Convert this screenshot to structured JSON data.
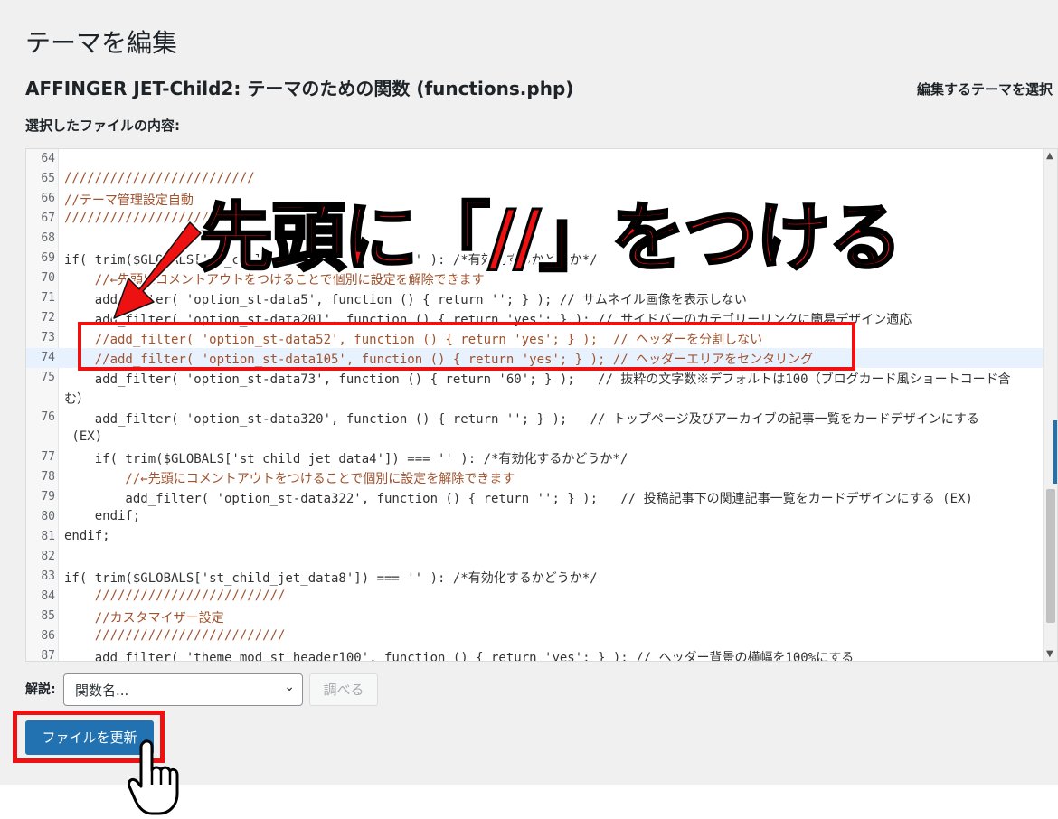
{
  "page": {
    "title": "テーマを編集",
    "subtitle": "AFFINGER JET-Child2: テーマのための関数 (functions.php)",
    "theme_select_label": "編集するテーマを選択",
    "file_label": "選択したファイルの内容:"
  },
  "editor": {
    "lines": [
      {
        "n": "64",
        "code": ""
      },
      {
        "n": "65",
        "code": "/////////////////////////"
      },
      {
        "n": "66",
        "code": "//テーマ管理設定自動"
      },
      {
        "n": "67",
        "code": "//////////////////////"
      },
      {
        "n": "68",
        "code": ""
      },
      {
        "n": "69",
        "code": "if( trim($GLOBALS['st_child_jet_data1']) === '' ): /*有効化するかどうか*/"
      },
      {
        "n": "70",
        "code": "    //←先頭にコメントアウトをつけることで個別に設定を解除できます"
      },
      {
        "n": "71",
        "code": "    add_filter( 'option_st-data5', function () { return ''; } ); // サムネイル画像を表示しない"
      },
      {
        "n": "72",
        "code": "    add_filter( 'option_st-data201', function () { return 'yes'; } ); // サイドバーのカテゴリーリンクに簡易デザイン適応"
      },
      {
        "n": "73",
        "code": "    //add_filter( 'option_st-data52', function () { return 'yes'; } );  // ヘッダーを分割しない"
      },
      {
        "n": "74",
        "code": "    //add_filter( 'option_st-data105', function () { return 'yes'; } ); // ヘッダーエリアをセンタリング"
      },
      {
        "n": "75",
        "code": "    add_filter( 'option_st-data73', function () { return '60'; } );   // 抜粋の文字数※デフォルトは100（ブログカード風ショートコード含"
      },
      {
        "n": "",
        "code": "む）"
      },
      {
        "n": "76",
        "code": "    add_filter( 'option_st-data320', function () { return ''; } );   // トップページ及びアーカイブの記事一覧をカードデザインにする"
      },
      {
        "n": "",
        "code": " (EX)"
      },
      {
        "n": "77",
        "code": "    if( trim($GLOBALS['st_child_jet_data4']) === '' ): /*有効化するかどうか*/"
      },
      {
        "n": "78",
        "code": "        //←先頭にコメントアウトをつけることで個別に設定を解除できます"
      },
      {
        "n": "79",
        "code": "        add_filter( 'option_st-data322', function () { return ''; } );   // 投稿記事下の関連記事一覧をカードデザインにする (EX)"
      },
      {
        "n": "80",
        "code": "    endif;"
      },
      {
        "n": "81",
        "code": "endif;"
      },
      {
        "n": "82",
        "code": ""
      },
      {
        "n": "83",
        "code": "if( trim($GLOBALS['st_child_jet_data8']) === '' ): /*有効化するかどうか*/"
      },
      {
        "n": "84",
        "code": "    /////////////////////////"
      },
      {
        "n": "85",
        "code": "    //カスタマイザー設定"
      },
      {
        "n": "86",
        "code": "    /////////////////////////"
      },
      {
        "n": "87",
        "code": "    add_filter( 'theme_mod_st_header100', function () { return 'yes'; } ); // ヘッダー背景の横幅を100%にする"
      }
    ],
    "active_line": "74"
  },
  "doc": {
    "label": "解説:",
    "select_value": "関数名...",
    "lookup_label": "調べる"
  },
  "update_button": "ファイルを更新",
  "annotation": "先頭に「//」をつける",
  "colors": {
    "accent": "#2271b1",
    "highlight_red": "#ee1111",
    "background": "#f0f0f1"
  }
}
